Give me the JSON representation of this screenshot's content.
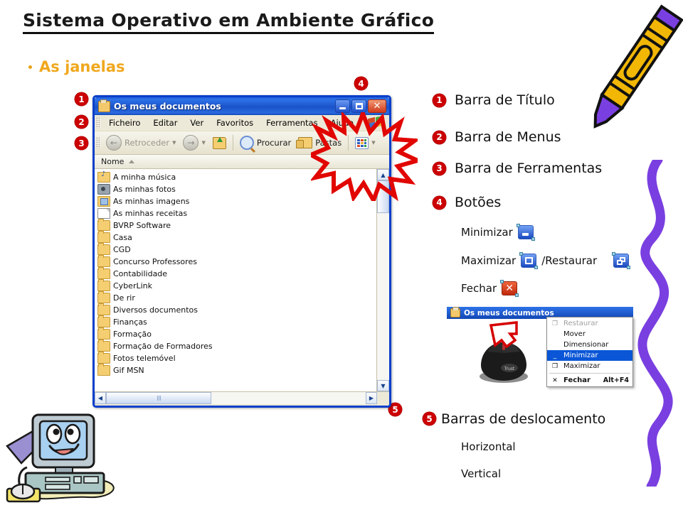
{
  "slide": {
    "title": "Sistema Operativo em Ambiente Gráfico",
    "bullet": "As janelas"
  },
  "explorer_window": {
    "title": "Os meus documentos",
    "title_icon": "folder-documents-icon",
    "window_buttons": {
      "minimize": "minimize-button",
      "maximize": "maximize-button",
      "close": "close-button"
    },
    "menus": [
      "Ficheiro",
      "Editar",
      "Ver",
      "Favoritos",
      "Ferramentas",
      "Ajuda"
    ],
    "toolbar": {
      "back": "Retroceder",
      "forward": "",
      "up": "",
      "search": "Procurar",
      "folders": "Pastas",
      "views": ""
    },
    "column_header": "Nome",
    "files": [
      {
        "name": "A minha música",
        "icon": "music-folder-icon"
      },
      {
        "name": "As minhas fotos",
        "icon": "photos-folder-icon"
      },
      {
        "name": "As minhas imagens",
        "icon": "images-folder-icon"
      },
      {
        "name": "As minhas receitas",
        "icon": "document-icon"
      },
      {
        "name": "BVRP Software",
        "icon": "folder-icon"
      },
      {
        "name": "Casa",
        "icon": "folder-icon"
      },
      {
        "name": "CGD",
        "icon": "folder-icon"
      },
      {
        "name": "Concurso Professores",
        "icon": "folder-icon"
      },
      {
        "name": "Contabilidade",
        "icon": "folder-icon"
      },
      {
        "name": "CyberLink",
        "icon": "folder-icon"
      },
      {
        "name": "De rir",
        "icon": "folder-icon"
      },
      {
        "name": "Diversos documentos",
        "icon": "folder-icon"
      },
      {
        "name": "Finanças",
        "icon": "folder-icon"
      },
      {
        "name": "Formação",
        "icon": "folder-icon"
      },
      {
        "name": "Formação de Formadores",
        "icon": "folder-icon"
      },
      {
        "name": "Fotos telemóvel",
        "icon": "folder-icon"
      },
      {
        "name": "Gif MSN",
        "icon": "folder-icon"
      }
    ]
  },
  "markers": {
    "m1": "1",
    "m2": "2",
    "m3": "3",
    "m4": "4",
    "m5": "5",
    "m5b": "5"
  },
  "legend": [
    {
      "num": "1",
      "label": "Barra de Título"
    },
    {
      "num": "2",
      "label": "Barra de Menus"
    },
    {
      "num": "3",
      "label": "Barra de Ferramentas"
    },
    {
      "num": "4",
      "label": "Botões"
    }
  ],
  "buttons_detail": {
    "minimize": "Minimizar",
    "maximize": "Maximizar",
    "restore_sep": "/Restaurar",
    "close": "Fechar"
  },
  "scroll_legend": {
    "num": "5",
    "label": "Barras de deslocamento",
    "horizontal": "Horizontal",
    "vertical": "Vertical"
  },
  "context_demo": {
    "window_title": "Os meus documentos",
    "menu": [
      {
        "label": "Restaurar",
        "icon": "restore-icon",
        "state": "disabled",
        "accel": ""
      },
      {
        "label": "Mover",
        "icon": "",
        "state": "normal",
        "accel": ""
      },
      {
        "label": "Dimensionar",
        "icon": "",
        "state": "normal",
        "accel": ""
      },
      {
        "label": "Minimizar",
        "icon": "minimize-icon",
        "state": "selected",
        "accel": ""
      },
      {
        "label": "Maximizar",
        "icon": "maximize-icon",
        "state": "normal",
        "accel": ""
      },
      {
        "label": "Fechar",
        "icon": "close-x-icon",
        "state": "normal",
        "accel": "Alt+F4"
      }
    ]
  },
  "colors": {
    "title_text": "#1a1a1a",
    "bullet_gold": "#F0A81E",
    "marker_red": "#CC0000",
    "window_blue": "#0A3FCB",
    "squiggle_purple": "#7A3FE0",
    "crayon_yellow": "#F2B705"
  }
}
